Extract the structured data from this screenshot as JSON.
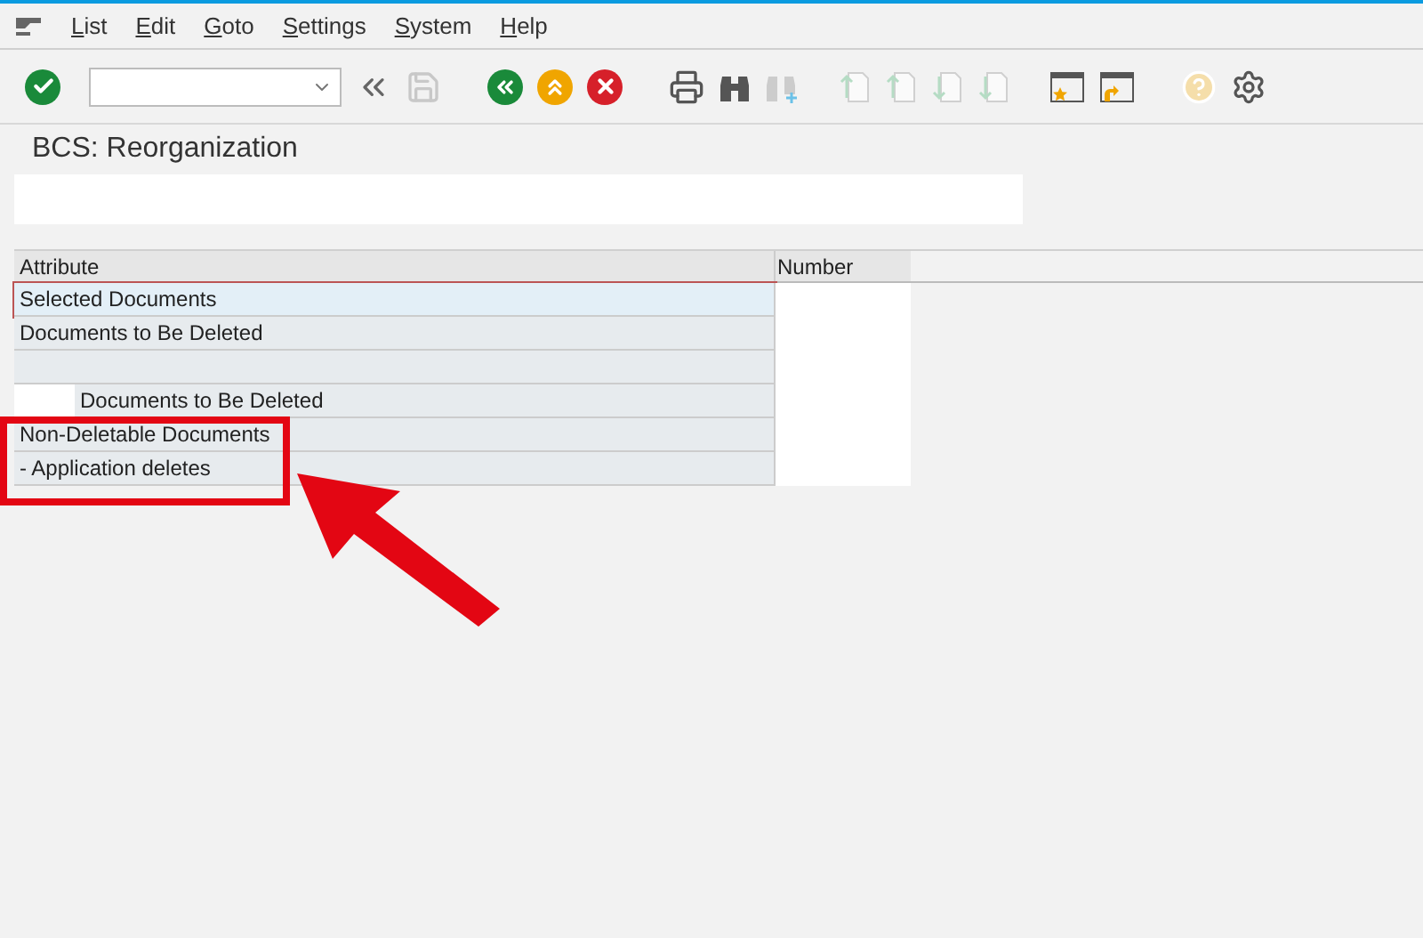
{
  "menu_bar": {
    "items": [
      {
        "label": "List"
      },
      {
        "label": "Edit"
      },
      {
        "label": "Goto"
      },
      {
        "label": "Settings"
      },
      {
        "label": "System"
      },
      {
        "label": "Help"
      }
    ]
  },
  "title": "BCS: Reorganization",
  "table": {
    "columns": [
      "Attribute",
      "Number"
    ],
    "rows": [
      {
        "kind": "text",
        "label": "Selected Documents",
        "selected": true
      },
      {
        "kind": "text",
        "label": "Documents to Be Deleted",
        "selected": false
      },
      {
        "kind": "blank",
        "selected": false
      },
      {
        "kind": "indented",
        "label": "Documents to Be Deleted",
        "selected": false
      },
      {
        "kind": "text",
        "label": "Non-Deletable Documents",
        "selected": false
      },
      {
        "kind": "text",
        "label": "- Application deletes",
        "selected": false
      }
    ]
  },
  "annotation": {
    "kind": "highlight-arrow"
  }
}
